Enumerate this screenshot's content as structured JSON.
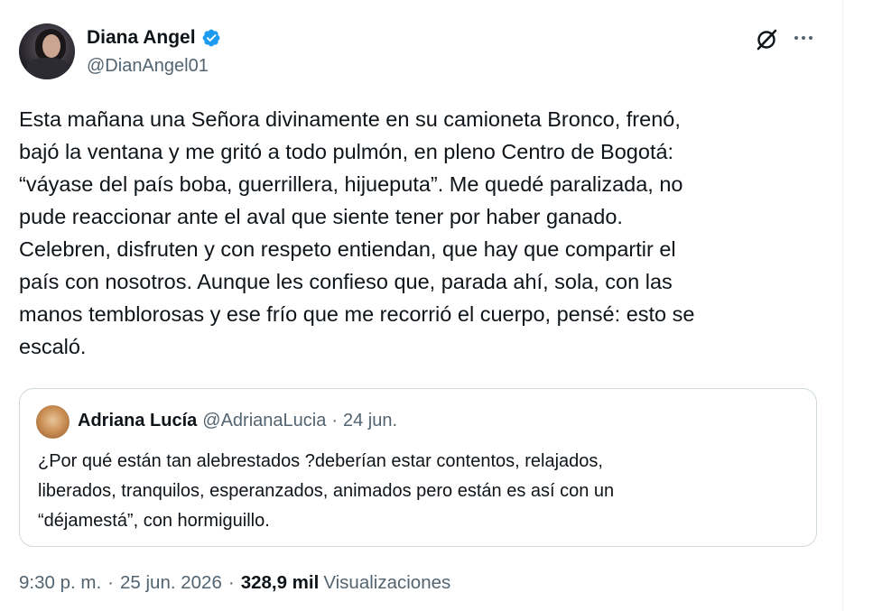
{
  "tweet": {
    "author": {
      "name": "Diana Angel",
      "handle": "@DianAngel01",
      "verified": true
    },
    "text": "Esta mañana una Señora divinamente en su camioneta Bronco, frenó,\nbajó la ventana y me gritó a todo pulmón, en pleno Centro de Bogotá:\n“váyase del país boba, guerrillera, hijueputa”. Me quedé paralizada, no\npude reaccionar ante el aval que siente tener por haber ganado.\nCelebren, disfruten y con respeto entiendan, que hay que compartir el\npaís con nosotros. Aunque les confieso que, parada ahí, sola, con las\nmanos temblorosas y ese frío que me recorrió el cuerpo, pensé: esto se\nescaló.",
    "time": "9:30 p. m.",
    "date": "25 jun. 2026",
    "views_count": "328,9 mil",
    "views_label": "Visualizaciones",
    "separator": "·"
  },
  "quote": {
    "name": "Adriana Lucía",
    "handle": "@AdrianaLucia",
    "date": "24 jun.",
    "separator": "·",
    "text": "¿Por qué están tan alebrestados ?deberían estar contentos, relajados,\nliberados, tranquilos, esperanzados, animados pero están es así con un\n“déjamestá”, con hormiguillo."
  },
  "icons": {
    "verified": "verified-badge-icon",
    "grok": "grok-icon",
    "more": "more-options-icon"
  },
  "colors": {
    "verified_blue": "#1d9bf0",
    "text_primary": "#0f1419",
    "text_secondary": "#536471",
    "border": "#cfd9de"
  }
}
